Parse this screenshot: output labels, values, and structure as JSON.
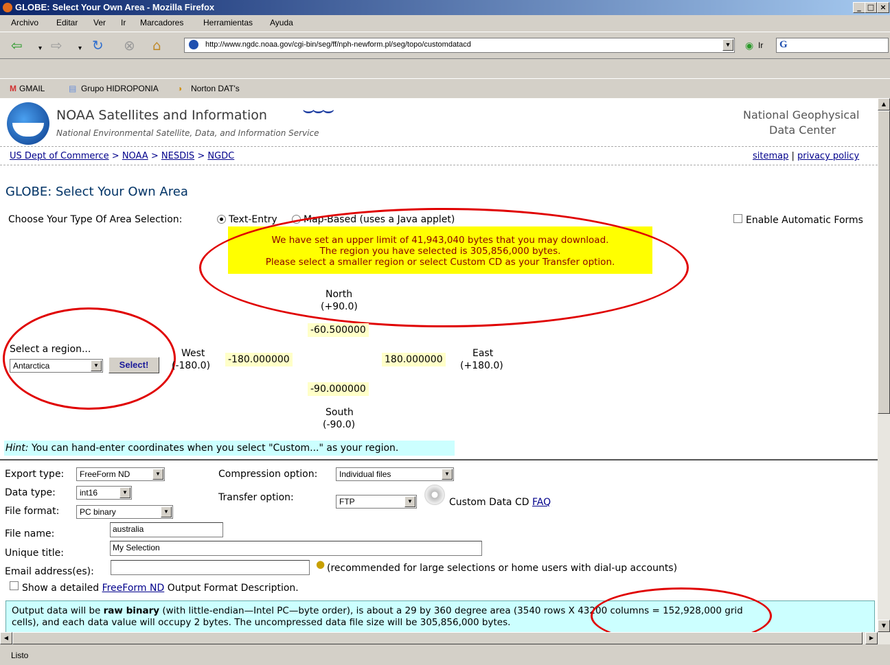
{
  "window": {
    "title": "GLOBE: Select Your Own Area - Mozilla Firefox",
    "controls": [
      "_",
      "□",
      "×"
    ]
  },
  "menu": [
    "Archivo",
    "Editar",
    "Ver",
    "Ir",
    "Marcadores",
    "Herramientas",
    "Ayuda"
  ],
  "nav": {
    "url": "http://www.ngdc.noaa.gov/cgi-bin/seg/ff/nph-newform.pl/seg/topo/customdatacd",
    "go_label": "Ir"
  },
  "bookmarks": [
    "GMAIL",
    "Grupo HIDROPONIA",
    "Norton DAT's"
  ],
  "header": {
    "noaa_title": "NOAA Satellites and Information",
    "noaa_subtitle": "National Environmental Satellite, Data, and Information Service",
    "ngdc_line1": "National Geophysical",
    "ngdc_line2": "Data Center"
  },
  "breadcrumb": [
    "US Dept of Commerce",
    "NOAA",
    "NESDIS",
    "NGDC"
  ],
  "breadcrumb_sep": ">",
  "toplinks": {
    "sitemap": "sitemap",
    "sep": "|",
    "privacy": "privacy policy"
  },
  "main": {
    "heading": "GLOBE: Select Your Own Area",
    "choose_label": "Choose Your Type Of Area Selection:",
    "option_text": "Text-Entry",
    "option_map": "Map-Based (uses a Java applet)",
    "auto_forms": "Enable Automatic Forms",
    "warning": [
      "We have set an upper limit of 41,943,040 bytes that you may download.",
      "The region you have selected is 305,856,000 bytes.",
      "Please select a smaller region or select Custom CD as your Transfer option."
    ]
  },
  "region": {
    "label": "Select a region...",
    "value": "Antarctica",
    "button": "Select!",
    "north": "North",
    "north_val": "(+90.0)",
    "south": "South",
    "south_val": "(-90.0)",
    "west": "West",
    "west_val": "(-180.0)",
    "east": "East",
    "east_val": "(+180.0)",
    "north_input": "-60.500000",
    "south_input": "-90.000000",
    "west_input": "-180.000000",
    "east_input": "180.000000"
  },
  "hint": {
    "label": "Hint:",
    "text": " You can hand-enter coordinates when you select \"Custom...\" as your region."
  },
  "form": {
    "export_label": "Export type:",
    "export_value": "FreeForm ND",
    "datatype_label": "Data type:",
    "datatype_value": "int16",
    "fileformat_label": "File format:",
    "fileformat_value": "PC binary",
    "compression_label": "Compression option:",
    "compression_value": "Individual files",
    "transfer_label": "Transfer option:",
    "transfer_value": "FTP",
    "custom_cd": "Custom Data CD",
    "faq": "FAQ",
    "filename_label": "File name:",
    "filename_value": "australia",
    "title_label": "Unique title:",
    "title_value": "My Selection",
    "email_label": "Email address(es):",
    "email_value": "",
    "email_note": "(recommended for large selections or home users with dial-up accounts)",
    "show_detailed_pre": "Show a detailed ",
    "show_detailed_link": "FreeForm ND",
    "show_detailed_post": " Output Format Description."
  },
  "output": {
    "pre": "Output data will be ",
    "bold": "raw binary",
    "post1": " (with little-endian—Intel PC—byte order), is about a 29 by 360 degree area (3540 rows X 43200 columns = 152,928,000 grid",
    "line2": "cells), and each data value will occupy 2 bytes. The uncompressed data file size will be 305,856,000 bytes."
  },
  "status": "Listo",
  "colors": {
    "highlight": "#e00000",
    "warning_bg": "#ffff00",
    "coord_bg": "#ffffc8",
    "hint_bg": "#ccffff",
    "link": "#00008b"
  }
}
